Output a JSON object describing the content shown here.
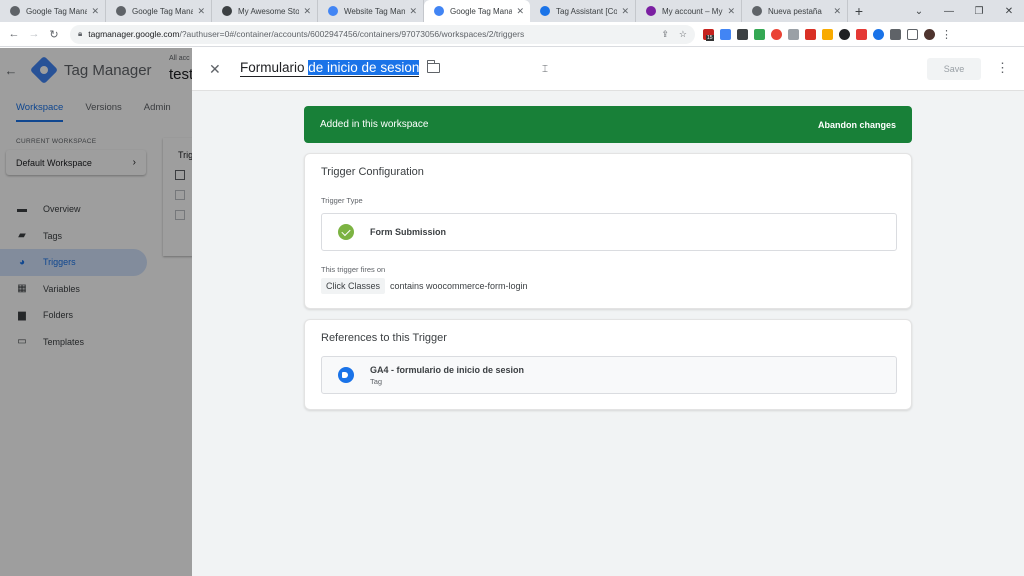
{
  "browser": {
    "tabs": [
      {
        "title": "Google Tag Mana",
        "active": false,
        "icon": "globe-icon",
        "color": "#5f6368"
      },
      {
        "title": "Google Tag Mana",
        "active": false,
        "icon": "globe-icon",
        "color": "#5f6368"
      },
      {
        "title": "My Awesome Sto",
        "active": false,
        "icon": "a-icon",
        "color": "#3c4043"
      },
      {
        "title": "Website Tag Mana",
        "active": false,
        "icon": "google-icon",
        "color": "#4285f4"
      },
      {
        "title": "Google Tag Mana",
        "active": true,
        "icon": "gtm-icon",
        "color": "#4285f4"
      },
      {
        "title": "Tag Assistant [Co",
        "active": false,
        "icon": "tag-icon",
        "color": "#1a73e8"
      },
      {
        "title": "My account – My",
        "active": false,
        "icon": "mail-icon",
        "color": "#7b1fa2"
      },
      {
        "title": "Nueva pestaña",
        "active": false,
        "icon": "chrome-icon",
        "color": "#5f6368"
      }
    ],
    "new_tab": "+",
    "url_host": "tagmanager.google.com",
    "url_path": "/?authuser=0#/container/accounts/6002947456/containers/97073056/workspaces/2/triggers",
    "extension_badge": "15"
  },
  "app": {
    "product_name": "Tag Manager",
    "account_label": "All acc",
    "account_name": "test",
    "nav_tabs": [
      "Workspace",
      "Versions",
      "Admin"
    ],
    "current_workspace_label": "CURRENT WORKSPACE",
    "workspace_name": "Default Workspace",
    "menu": [
      {
        "label": "Overview",
        "icon": "overview-icon"
      },
      {
        "label": "Tags",
        "icon": "tag-icon"
      },
      {
        "label": "Triggers",
        "icon": "trigger-icon",
        "active": true
      },
      {
        "label": "Variables",
        "icon": "variables-icon"
      },
      {
        "label": "Folders",
        "icon": "folder-icon"
      },
      {
        "label": "Templates",
        "icon": "templates-icon"
      }
    ],
    "list_header": "Trig"
  },
  "panel": {
    "name_plain": "Formulario ",
    "name_selected": "de inicio de sesion",
    "save_label": "Save",
    "banner_text": "Added in this workspace",
    "abandon_label": "Abandon changes",
    "config_title": "Trigger Configuration",
    "trigger_type_label": "Trigger Type",
    "trigger_type": "Form Submission",
    "fires_on_label": "This trigger fires on",
    "condition_variable": "Click Classes",
    "condition_text": "contains woocommerce-form-login",
    "references_title": "References to this Trigger",
    "reference_name": "GA4 - formulario de inicio de sesion",
    "reference_type": "Tag",
    "banner_color": "#188038"
  }
}
